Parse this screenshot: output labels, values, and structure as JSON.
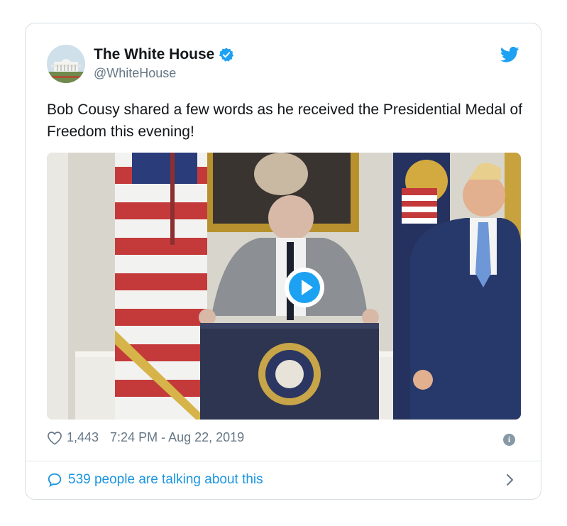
{
  "tweet": {
    "author_name": "The White House",
    "author_handle": "@WhiteHouse",
    "text": "Bob Cousy shared a few words as he received the Presidential Medal of Freedom this evening!",
    "likes": "1,443",
    "timestamp": "7:24 PM - Aug 22, 2019",
    "conversation": "539 people are talking about this"
  },
  "colors": {
    "twitter_blue": "#1da1f2",
    "link_blue": "#1b95e0",
    "muted_gray": "#657786"
  },
  "icons": {
    "verified": "verified-badge-icon",
    "logo": "twitter-bird-icon",
    "like": "heart-icon",
    "info": "info-icon",
    "reply": "speech-bubble-icon",
    "more": "chevron-right-icon",
    "play": "play-icon"
  }
}
